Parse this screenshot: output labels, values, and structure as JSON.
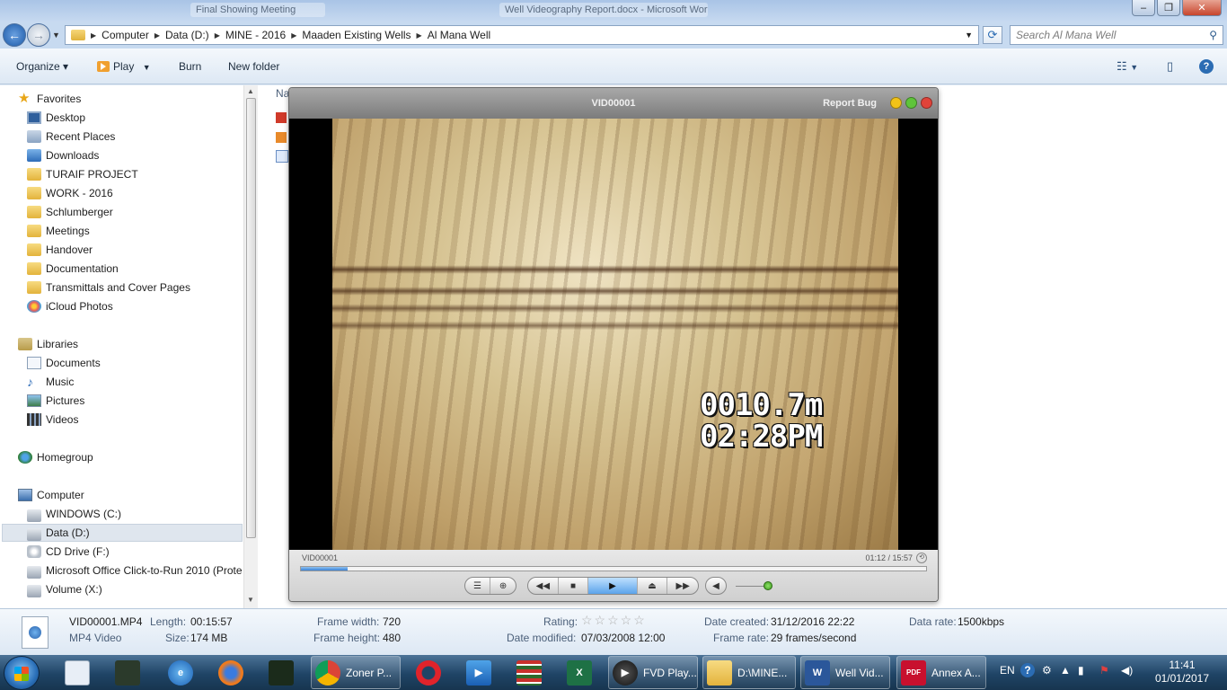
{
  "titlebar": {
    "ghost_tab_1": "Final Showing Meeting",
    "ghost_title": "Well Videography Report.docx - Microsoft Word"
  },
  "address": {
    "crumbs": [
      "Computer",
      "Data (D:)",
      "MINE - 2016",
      "Maaden Existing Wells",
      "Al Mana Well"
    ]
  },
  "search": {
    "placeholder": "Search Al Mana Well"
  },
  "toolbar": {
    "organize": "Organize ▾",
    "play": "Play",
    "burn": "Burn",
    "new_folder": "New folder"
  },
  "nav": {
    "favorites": "Favorites",
    "fav_items": [
      "Desktop",
      "Recent Places",
      "Downloads",
      "TURAIF PROJECT",
      "WORK - 2016",
      "Schlumberger",
      "Meetings",
      "Handover",
      "Documentation",
      "Transmittals and Cover Pages",
      "iCloud Photos"
    ],
    "libraries": "Libraries",
    "lib_items": [
      "Documents",
      "Music",
      "Pictures",
      "Videos"
    ],
    "homegroup": "Homegroup",
    "computer": "Computer",
    "drives": [
      "WINDOWS (C:)",
      "Data (D:)",
      "CD Drive (F:)",
      "Microsoft Office Click-to-Run 2010 (Prote",
      "Volume (X:)"
    ]
  },
  "content": {
    "column_header": "Na"
  },
  "player": {
    "title": "VID00001",
    "report_bug": "Report Bug",
    "depth": "0010.7m",
    "time_overlay": "02:28PM",
    "file_label": "VID00001",
    "time": "01:12 / 15:57",
    "progress": 0.075,
    "volume": 0.9,
    "colors": {
      "close": "#e0433a",
      "minimize": "#f2c318",
      "zoom": "#5fc43a",
      "progress": "#3a82d6"
    }
  },
  "details": {
    "filename": "VID00001.MP4",
    "type": "MP4 Video",
    "length_label": "Length:",
    "length": "00:15:57",
    "size_label": "Size:",
    "size": "174 MB",
    "frame_width_label": "Frame width:",
    "frame_width": "720",
    "frame_height_label": "Frame height:",
    "frame_height": "480",
    "rating_label": "Rating:",
    "rating": 0,
    "date_modified_label": "Date modified:",
    "date_modified": "07/03/2008 12:00",
    "date_created_label": "Date created:",
    "date_created": "31/12/2016 22:22",
    "frame_rate_label": "Frame rate:",
    "frame_rate": "29 frames/second",
    "data_rate_label": "Data rate:",
    "data_rate": "1500kbps"
  },
  "taskbar": {
    "zoner": "Zoner P...",
    "fvd": "FVD Play...",
    "explorer": "D:\\MINE...",
    "word": "Well Vid...",
    "pdf": "Annex A...",
    "lang": "EN",
    "time": "11:41",
    "date": "01/01/2017"
  }
}
